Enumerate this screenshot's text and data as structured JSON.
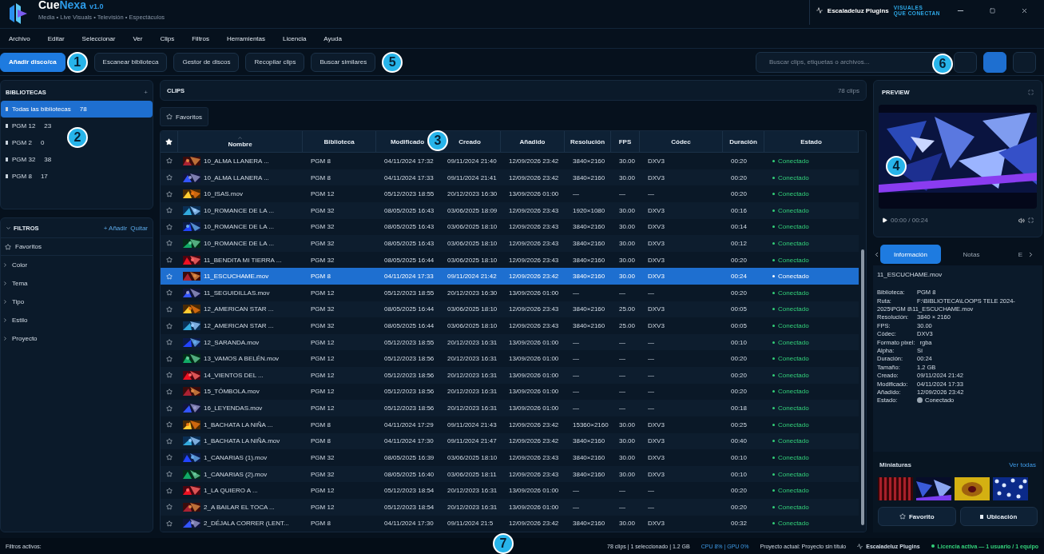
{
  "app": {
    "name_first": "Cue",
    "name_second": "Nexa",
    "version": "v1.0",
    "tagline": "Media • Live Visuals • Televisión • Espectáculos"
  },
  "brand": {
    "name": "Escaladeluz Plugins",
    "motto_1": "VISUALES",
    "motto_2": "QUE CONECTAN"
  },
  "menu": [
    "Archivo",
    "Editar",
    "Seleccionar",
    "Ver",
    "Clips",
    "Filtros",
    "Herramientas",
    "Licencia",
    "Ayuda"
  ],
  "toolbar": {
    "buttons": [
      {
        "label": "Añadir disco/ca",
        "primary": true
      },
      {
        "label": "Escanear biblioteca",
        "primary": false
      },
      {
        "label": "Gestor de discos",
        "primary": false
      },
      {
        "label": "Recopilar clips",
        "primary": false
      },
      {
        "label": "Buscar similares",
        "primary": false
      }
    ],
    "search": {
      "placeholder": "Buscar clips, etiquetas o archivos..."
    },
    "tool_buttons": [
      {
        "selected": false
      },
      {
        "selected": true
      },
      {
        "selected": false
      }
    ]
  },
  "libraries": {
    "title": "BIBLIOTECAS",
    "add": "+",
    "items": [
      {
        "name": "Todas las bibliotecas",
        "count": "78",
        "selected": true
      },
      {
        "name": "PGM 12",
        "count": "23",
        "selected": false
      },
      {
        "name": "PGM 2",
        "count": "0",
        "selected": false
      },
      {
        "name": "PGM 32",
        "count": "38",
        "selected": false
      },
      {
        "name": "PGM 8",
        "count": "17",
        "selected": false
      }
    ]
  },
  "filters": {
    "title": "FILTROS",
    "add": "+ Añadir",
    "remove": "Quitar",
    "favorites": "Favoritos",
    "groups": [
      {
        "label": "Color",
        "expanded": false
      },
      {
        "label": "Tema",
        "expanded": false
      },
      {
        "label": "Tipo",
        "expanded": false
      },
      {
        "label": "Estilo",
        "expanded": false
      },
      {
        "label": "Proyecto",
        "expanded": false
      }
    ]
  },
  "clips": {
    "title": "CLIPS",
    "count": "78 clips",
    "chip": "Favoritos",
    "columns": [
      "Nombre",
      "Biblioteca",
      "Modificado",
      "Creado",
      "Añadido",
      "Resolución",
      "FPS",
      "Códec",
      "Duración",
      "Estado"
    ],
    "rows": [
      {
        "favorite": false,
        "selected": false,
        "cells": [
          "10_ALMA LLANERA ...",
          "PGM 8",
          "04/11/2024 17:32",
          "09/11/2024 21:40",
          "12/09/2026 23:42",
          "3840×2160",
          "30.00",
          "DXV3",
          "00:20",
          "Conectado"
        ]
      },
      {
        "favorite": false,
        "selected": false,
        "cells": [
          "10_ALMA LLANERA ...",
          "PGM 8",
          "04/11/2024 17:33",
          "09/11/2024 21:41",
          "12/09/2026 23:42",
          "3840×2160",
          "30.00",
          "DXV3",
          "00:20",
          "Conectado"
        ]
      },
      {
        "favorite": false,
        "selected": false,
        "cells": [
          "10_ISAS.mov",
          "PGM 12",
          "05/12/2023 18:55",
          "20/12/2023 16:30",
          "13/09/2026 01:00",
          "—",
          "—",
          "—",
          "00:20",
          "Conectado"
        ]
      },
      {
        "favorite": false,
        "selected": false,
        "cells": [
          "10_ROMANCE DE LA ...",
          "PGM 32",
          "08/05/2025 16:43",
          "03/06/2025 18:09",
          "12/09/2026 23:43",
          "1920×1080",
          "30.00",
          "DXV3",
          "00:16",
          "Conectado"
        ]
      },
      {
        "favorite": false,
        "selected": false,
        "cells": [
          "10_ROMANCE DE LA ...",
          "PGM 32",
          "08/05/2025 16:43",
          "03/06/2025 18:10",
          "12/09/2026 23:43",
          "3840×2160",
          "30.00",
          "DXV3",
          "00:14",
          "Conectado"
        ]
      },
      {
        "favorite": false,
        "selected": false,
        "cells": [
          "10_ROMANCE DE LA ...",
          "PGM 32",
          "08/05/2025 16:43",
          "03/06/2025 18:10",
          "12/09/2026 23:43",
          "3840×2160",
          "30.00",
          "DXV3",
          "00:12",
          "Conectado"
        ]
      },
      {
        "favorite": false,
        "selected": false,
        "cells": [
          "11_BENDITA MI TIERRA ...",
          "PGM 32",
          "08/05/2025 16:44",
          "03/06/2025 18:10",
          "12/09/2026 23:43",
          "3840×2160",
          "30.00",
          "DXV3",
          "00:20",
          "Conectado"
        ]
      },
      {
        "favorite": false,
        "selected": true,
        "cells": [
          "11_ESCUCHAME.mov",
          "PGM 8",
          "04/11/2024 17:33",
          "09/11/2024 21:42",
          "12/09/2026 23:42",
          "3840×2160",
          "30.00",
          "DXV3",
          "00:24",
          "Conectado"
        ]
      },
      {
        "favorite": false,
        "selected": false,
        "cells": [
          "11_SEGUIDILLAS.mov",
          "PGM 12",
          "05/12/2023 18:55",
          "20/12/2023 16:30",
          "13/09/2026 01:00",
          "—",
          "—",
          "—",
          "00:20",
          "Conectado"
        ]
      },
      {
        "favorite": false,
        "selected": false,
        "cells": [
          "12_AMERICAN STAR ...",
          "PGM 32",
          "08/05/2025 16:44",
          "03/06/2025 18:10",
          "12/09/2026 23:43",
          "3840×2160",
          "25.00",
          "DXV3",
          "00:05",
          "Conectado"
        ]
      },
      {
        "favorite": false,
        "selected": false,
        "cells": [
          "12_AMERICAN STAR ...",
          "PGM 32",
          "08/05/2025 16:44",
          "03/06/2025 18:10",
          "12/09/2026 23:43",
          "3840×2160",
          "25.00",
          "DXV3",
          "00:05",
          "Conectado"
        ]
      },
      {
        "favorite": false,
        "selected": false,
        "cells": [
          "12_SARANDA.mov",
          "PGM 12",
          "05/12/2023 18:55",
          "20/12/2023 16:31",
          "13/09/2026 01:00",
          "—",
          "—",
          "—",
          "00:10",
          "Conectado"
        ]
      },
      {
        "favorite": false,
        "selected": false,
        "cells": [
          "13_VAMOS A BELÉN.mov",
          "PGM 12",
          "05/12/2023 18:56",
          "20/12/2023 16:31",
          "13/09/2026 01:00",
          "—",
          "—",
          "—",
          "00:20",
          "Conectado"
        ]
      },
      {
        "favorite": false,
        "selected": false,
        "cells": [
          "14_VIENTOS DEL ...",
          "PGM 12",
          "05/12/2023 18:56",
          "20/12/2023 16:31",
          "13/09/2026 01:00",
          "—",
          "—",
          "—",
          "00:20",
          "Conectado"
        ]
      },
      {
        "favorite": false,
        "selected": false,
        "cells": [
          "15_TÓMBOLA.mov",
          "PGM 12",
          "05/12/2023 18:56",
          "20/12/2023 16:31",
          "13/09/2026 01:00",
          "—",
          "—",
          "—",
          "00:20",
          "Conectado"
        ]
      },
      {
        "favorite": false,
        "selected": false,
        "cells": [
          "16_LEYENDAS.mov",
          "PGM 12",
          "05/12/2023 18:56",
          "20/12/2023 16:31",
          "13/09/2026 01:00",
          "—",
          "—",
          "—",
          "00:18",
          "Conectado"
        ]
      },
      {
        "favorite": false,
        "selected": false,
        "cells": [
          "1_BACHATA LA NIÑA ...",
          "PGM 8",
          "04/11/2024 17:29",
          "09/11/2024 21:43",
          "12/09/2026 23:42",
          "15360×2160",
          "30.00",
          "DXV3",
          "00:25",
          "Conectado"
        ]
      },
      {
        "favorite": false,
        "selected": false,
        "cells": [
          "1_BACHATA LA NIÑA.mov",
          "PGM 8",
          "04/11/2024 17:30",
          "09/11/2024 21:47",
          "12/09/2026 23:42",
          "3840×2160",
          "30.00",
          "DXV3",
          "00:40",
          "Conectado"
        ]
      },
      {
        "favorite": false,
        "selected": false,
        "cells": [
          "1_CANARIAS (1).mov",
          "PGM 32",
          "08/05/2025 16:39",
          "03/06/2025 18:10",
          "12/09/2026 23:43",
          "3840×2160",
          "30.00",
          "DXV3",
          "00:10",
          "Conectado"
        ]
      },
      {
        "favorite": false,
        "selected": false,
        "cells": [
          "1_CANARIAS (2).mov",
          "PGM 32",
          "08/05/2025 16:40",
          "03/06/2025 18:11",
          "12/09/2026 23:43",
          "3840×2160",
          "30.00",
          "DXV3",
          "00:10",
          "Conectado"
        ]
      },
      {
        "favorite": false,
        "selected": false,
        "cells": [
          "1_LA QUIERO A ...",
          "PGM 12",
          "05/12/2023 18:54",
          "20/12/2023 16:31",
          "13/09/2026 01:00",
          "—",
          "—",
          "—",
          "00:20",
          "Conectado"
        ]
      },
      {
        "favorite": false,
        "selected": false,
        "cells": [
          "2_A BAILAR EL TOCA ...",
          "PGM 12",
          "05/12/2023 18:54",
          "20/12/2023 16:31",
          "13/09/2026 01:00",
          "—",
          "—",
          "—",
          "00:20",
          "Conectado"
        ]
      },
      {
        "favorite": false,
        "selected": false,
        "cells": [
          "2_DÉJALA CORRER (LENT...",
          "PGM 8",
          "04/11/2024 17:30",
          "09/11/2024 21:5",
          "12/09/2026 23:42",
          "3840×2160",
          "30.00",
          "DXV3",
          "00:32",
          "Conectado"
        ]
      }
    ]
  },
  "preview": {
    "title": "PREVIEW",
    "time": "00:00 / 00:24"
  },
  "details": {
    "tabs": [
      {
        "label": "Información",
        "selected": true
      },
      {
        "label": "Notas",
        "selected": false
      },
      {
        "label": "E",
        "selected": false
      }
    ],
    "filename": "11_ESCUCHAME.mov",
    "fields": [
      {
        "kind": "text",
        "label": "Biblioteca:",
        "value": "PGM 8"
      },
      {
        "kind": "text",
        "label": "Ruta:",
        "value": "F:\\BIBLIOTECA\\LOOPS TELE 2024-2025\\PGM 8\\11_ESCUCHAME.mov"
      },
      {
        "kind": "text",
        "label": "Resolución:",
        "value": "3840 × 2160"
      },
      {
        "kind": "text",
        "label": "FPS:",
        "value": "30.00"
      },
      {
        "kind": "text",
        "label": "Códec:",
        "value": "DXV3"
      },
      {
        "kind": "text",
        "label": "Formato pixel:",
        "value": "rgba"
      },
      {
        "kind": "text",
        "label": "Alpha:",
        "value": "Sí"
      },
      {
        "kind": "text",
        "label": "Duración:",
        "value": "00:24"
      },
      {
        "kind": "text",
        "label": "Tamaño:",
        "value": "1.2 GB"
      },
      {
        "kind": "text",
        "label": "Creado:",
        "value": "09/11/2024 21:42"
      },
      {
        "kind": "text",
        "label": "Modificado:",
        "value": "04/11/2024 17:33"
      },
      {
        "kind": "text",
        "label": "Añadido:",
        "value": "12/09/2026 23:42"
      },
      {
        "kind": "status",
        "label": "Estado:",
        "value": "Conectado",
        "color": "#9aa6b2"
      }
    ],
    "thumbs_title": "Miniaturas",
    "thumbs_link": "Ver todas",
    "buttons": [
      "Favorito",
      "Ubicación"
    ]
  },
  "status_bar": {
    "filters": "Filtros activos:",
    "summary": "78 clips | 1 seleccionado | 1.2 GB",
    "usage": "CPU 8% | GPU 0%",
    "project": "Proyecto actual: Proyecto sin título",
    "brand": "Escaladeluz Plugins",
    "license": "Licencia activa — 1 usuario / 1 equipo"
  },
  "callouts": [
    "1",
    "2",
    "3",
    "4",
    "5",
    "6",
    "7"
  ]
}
